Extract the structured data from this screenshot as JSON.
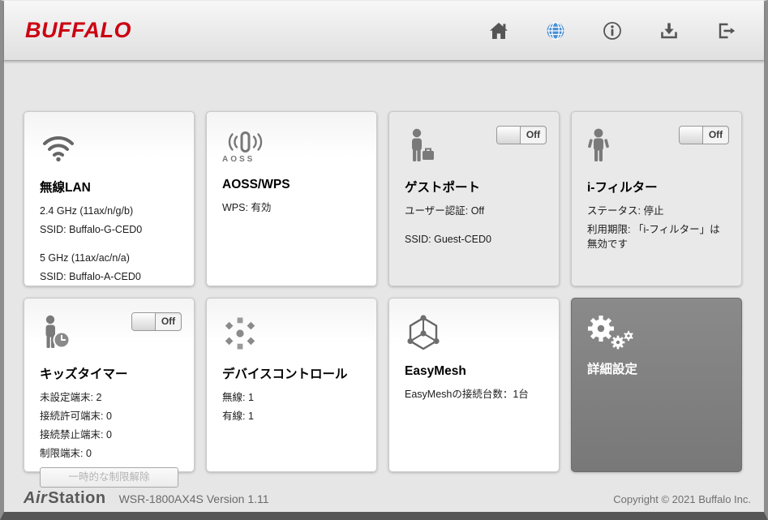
{
  "brand": {
    "logo_text": "BUFFALO",
    "logo_color": "#cc0011"
  },
  "header": {
    "icon_color": "#555555",
    "active_icon_color": "#4a8fd4",
    "icons": [
      {
        "name": "home",
        "active": false
      },
      {
        "name": "globe",
        "active": true
      },
      {
        "name": "info",
        "active": false
      },
      {
        "name": "download",
        "active": false
      },
      {
        "name": "logout",
        "active": false
      }
    ]
  },
  "cards": [
    {
      "title": "無線LAN",
      "lines": [
        "2.4 GHz (11ax/n/g/b)",
        "SSID: Buffalo-G-CED0",
        "5 GHz (11ax/ac/n/a)",
        "SSID: Buffalo-A-CED0"
      ]
    },
    {
      "title": "AOSS/WPS",
      "icon_caption": "AOSS",
      "lines": [
        "WPS: 有効"
      ]
    },
    {
      "title": "ゲストポート",
      "toggle_label": "Off",
      "lines": [
        "ユーザー認証: Off",
        "SSID: Guest-CED0"
      ]
    },
    {
      "title": "i-フィルター",
      "toggle_label": "Off",
      "lines": [
        "ステータス: 停止",
        "利用期限: 「i-フィルター」は無効です"
      ]
    },
    {
      "title": "キッズタイマー",
      "toggle_label": "Off",
      "lines": [
        "未設定端末: 2",
        "接続許可端末: 0",
        "接続禁止端末: 0",
        "制限端末: 0"
      ],
      "button_label": "一時的な制限解除"
    },
    {
      "title": "デバイスコントロール",
      "lines": [
        "無線: 1",
        "有線: 1"
      ]
    },
    {
      "title": "EasyMesh",
      "lines": [
        "EasyMeshの接続台数：1台"
      ]
    },
    {
      "title": "詳細設定",
      "lines": []
    }
  ],
  "footer": {
    "logo_air": "Air",
    "logo_station": "Station",
    "version": "WSR-1800AX4S Version 1.11",
    "copyright": "Copyright © 2021 Buffalo Inc."
  },
  "colors": {
    "dark_card": "#7d7d7d",
    "page_bg": "#e6e6e6",
    "frame": "#8d8d8d"
  }
}
